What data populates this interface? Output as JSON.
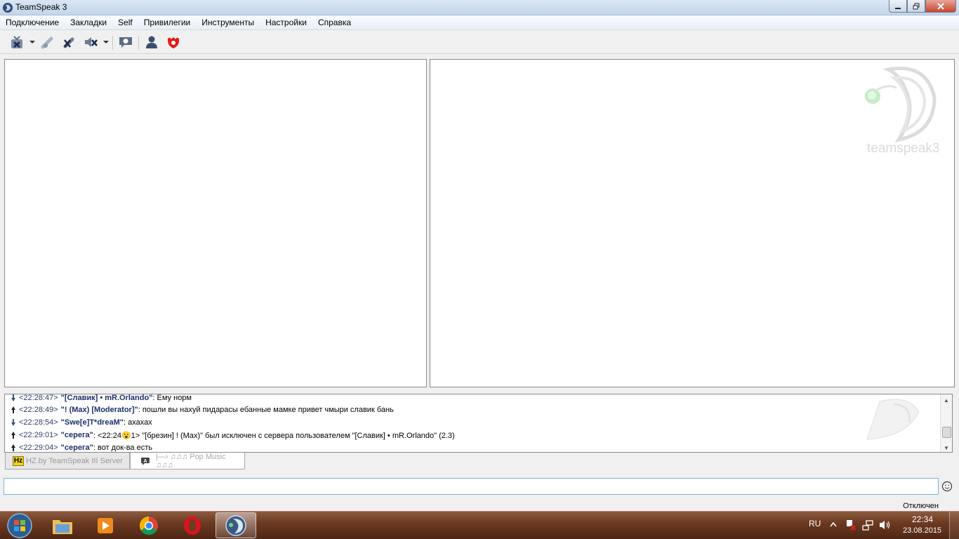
{
  "window": {
    "title": "TeamSpeak 3",
    "minimize_icon": "minimize-icon",
    "maximize_icon": "restore-icon",
    "close_icon": "close-icon"
  },
  "menu": {
    "items": [
      "Подключение",
      "Закладки",
      "Self",
      "Привилегии",
      "Инструменты",
      "Настройки",
      "Справка"
    ]
  },
  "toolbar": {
    "icons": [
      "disconnect-icon",
      "away-icon",
      "mute-microphone-icon",
      "mute-speakers-icon",
      "subscribe-chat-icon",
      "contacts-icon",
      "ts-logo-icon"
    ]
  },
  "info_pane": {
    "watermark": "teamspeak3"
  },
  "chat": {
    "lines": [
      {
        "dir": "down",
        "time": "<22:28:47>",
        "nick": "\"[Славик] • mR.Orlando\"",
        "msg": ": Ему норм"
      },
      {
        "dir": "up",
        "time": "<22:28:49>",
        "nick": "\"! (Max) [Moderator]\"",
        "msg": ": пошли вы нахуй пидарасы ебанные мамке привет чмыри славик бань"
      },
      {
        "dir": "down",
        "time": "<22:28:54>",
        "nick": "\"Swe[e]T*dreaM\"",
        "msg": ": ахахах"
      },
      {
        "dir": "up",
        "time": "<22:29:01>",
        "nick": "\"серега\"",
        "msg": ": <22:24😮1> \"[брезин] ! (Max)\" был исключен с сервера пользователем \"[Славик] • mR.Orlando\" (2.3)"
      },
      {
        "dir": "up",
        "time": "<22:29:04>",
        "nick": "\"серега\"",
        "msg": ": вот док-ва есть"
      }
    ]
  },
  "tabs": {
    "server": {
      "badge": "Hz",
      "label": "HZ.by TeamSpeak III Server"
    },
    "channel": {
      "label": "|—› ♫♫♫ Pop Music ♫♫♫"
    }
  },
  "input": {
    "value": "",
    "placeholder": ""
  },
  "status": {
    "text": "Отключен"
  },
  "taskbar": {
    "apps": [
      "explorer-icon",
      "media-player-icon",
      "chrome-icon",
      "opera-icon",
      "teamspeak-icon"
    ],
    "language": "RU",
    "time": "22:34",
    "date": "23.08.2015"
  },
  "colors": {
    "accent": "#1a2f6b",
    "titlebar": "#c4d6ea",
    "taskbar": "#6d3a22"
  }
}
